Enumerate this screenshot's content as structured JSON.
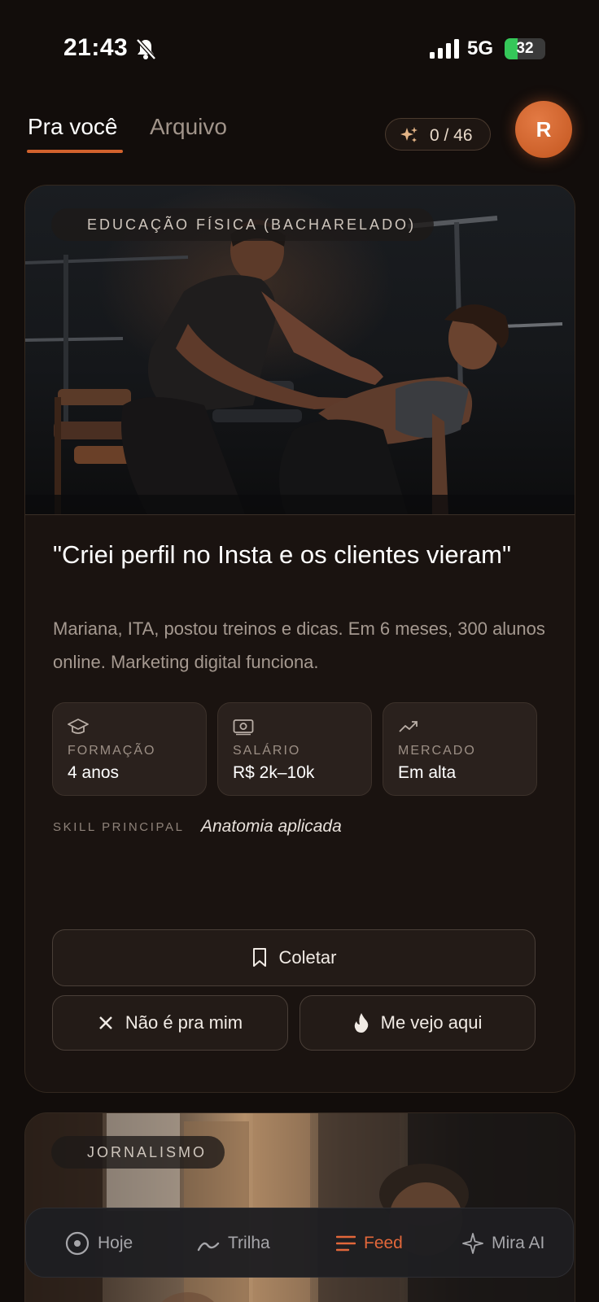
{
  "status_bar": {
    "time": "21:43",
    "network": "5G",
    "battery": "32",
    "battery_level": 0.32,
    "silent_icon": "bell-slash-icon",
    "signal_icon": "cellular-signal-icon"
  },
  "header": {
    "tabs": [
      {
        "label": "Pra você",
        "active": true
      },
      {
        "label": "Arquivo",
        "active": false
      }
    ],
    "counter": {
      "icon": "sparkles-icon",
      "text": "0 / 46"
    },
    "avatar_initial": "R"
  },
  "card": {
    "category": "EDUCAÇÃO FÍSICA (BACHARELADO)",
    "image": "personal-trainer-coaching-woman-gym-photo",
    "title": "\"Criei perfil no Insta e os clientes vieram\"",
    "description": "Mariana, ITA, postou treinos e dicas. Em 6 meses, 300 alunos online. Marketing digital funciona.",
    "stats": [
      {
        "icon": "graduation-cap-icon",
        "label": "FORMAÇÃO",
        "value": "4 anos"
      },
      {
        "icon": "banknote-icon",
        "label": "SALÁRIO",
        "value": "R$ 2k–10k"
      },
      {
        "icon": "trending-up-icon",
        "label": "MERCADO",
        "value": "Em alta"
      }
    ],
    "skill_label": "SKILL PRINCIPAL",
    "skill_value": "Anatomia aplicada",
    "actions": {
      "collect": {
        "label": "Coletar",
        "icon": "bookmark-icon"
      },
      "dismiss": {
        "label": "Não é pra mim",
        "icon": "x-icon"
      },
      "like": {
        "label": "Me vejo aqui",
        "icon": "flame-icon"
      }
    }
  },
  "next_card": {
    "category": "JORNALISMO",
    "image": "city-street-sunset-photo"
  },
  "bottom_nav": {
    "items": [
      {
        "label": "Hoje",
        "icon": "target-circle-icon",
        "active": false
      },
      {
        "label": "Trilha",
        "icon": "path-curve-icon",
        "active": false
      },
      {
        "label": "Feed",
        "icon": "feed-lines-icon",
        "active": true
      },
      {
        "label": "Mira AI",
        "icon": "sparkle-icon",
        "active": false
      }
    ],
    "accent_color": "#e2673a"
  },
  "colors": {
    "background": "#120d0b",
    "accent": "#d2622d",
    "card": "#1a1310"
  }
}
